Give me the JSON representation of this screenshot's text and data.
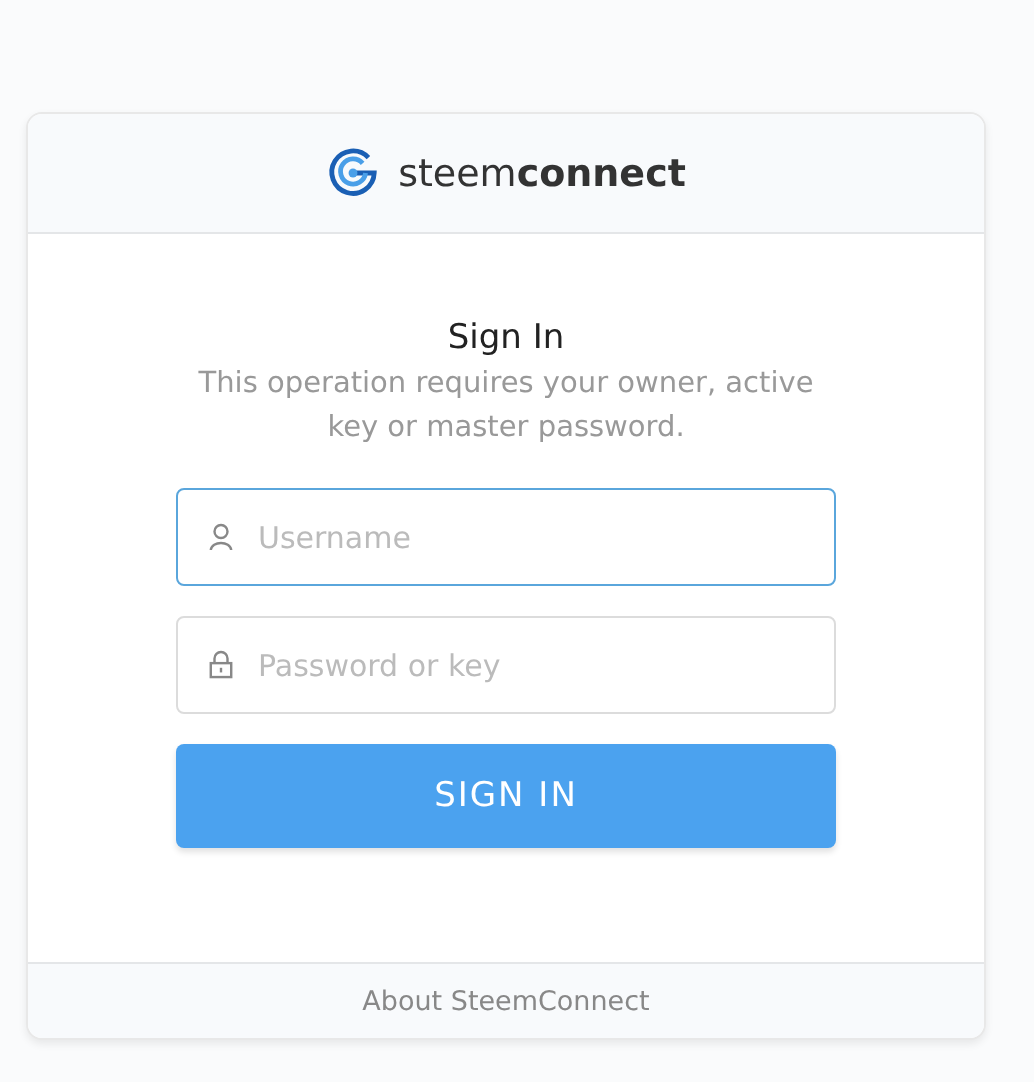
{
  "header": {
    "logo_text": "steem**connect**"
  },
  "form": {
    "title": "Sign In",
    "description": "This operation requires your owner, active key or master password.",
    "fields": [
      {
        "kind": "user",
        "placeholder": "Username",
        "focused": true
      },
      {
        "kind": "lock",
        "placeholder": "Password or key",
        "focused": false
      }
    ],
    "submit": "SIGN IN"
  },
  "footer": {
    "link": "About SteemConnect"
  }
}
